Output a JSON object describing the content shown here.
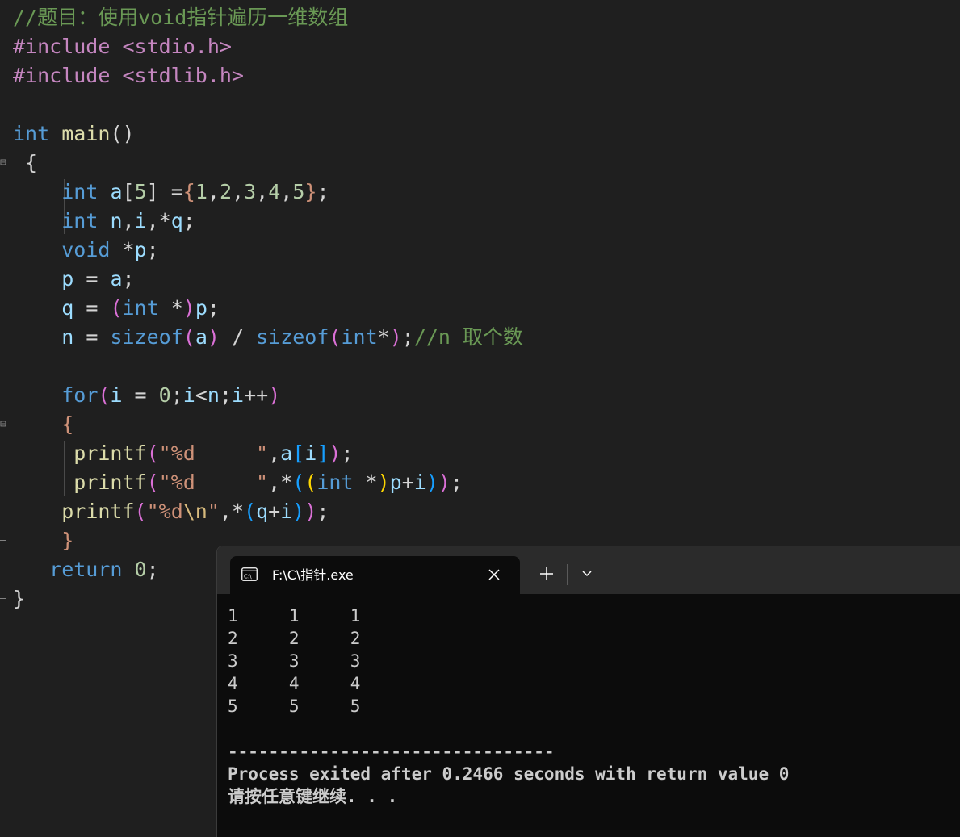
{
  "editor": {
    "lines": [
      [
        {
          "t": "//题目：使用void指针遍历一维数组",
          "c": "cm"
        }
      ],
      [
        {
          "t": "#include ",
          "c": "pp"
        },
        {
          "t": "<stdio.h>",
          "c": "pp"
        }
      ],
      [
        {
          "t": "#include ",
          "c": "pp"
        },
        {
          "t": "<stdlib.h>",
          "c": "pp"
        }
      ],
      [],
      [
        {
          "t": "int",
          "c": "kw"
        },
        {
          "t": " ",
          "c": "op"
        },
        {
          "t": "main",
          "c": "fn"
        },
        {
          "t": "()",
          "c": "op"
        }
      ],
      [
        {
          "t": " {",
          "c": "op"
        }
      ],
      [
        {
          "t": "    ",
          "c": "op"
        },
        {
          "t": "int",
          "c": "kw"
        },
        {
          "t": " ",
          "c": "op"
        },
        {
          "t": "a",
          "c": "id"
        },
        {
          "t": "[",
          "c": "op"
        },
        {
          "t": "5",
          "c": "nm"
        },
        {
          "t": "] =",
          "c": "op"
        },
        {
          "t": "{",
          "c": "br"
        },
        {
          "t": "1",
          "c": "nm"
        },
        {
          "t": ",",
          "c": "op"
        },
        {
          "t": "2",
          "c": "nm"
        },
        {
          "t": ",",
          "c": "op"
        },
        {
          "t": "3",
          "c": "nm"
        },
        {
          "t": ",",
          "c": "op"
        },
        {
          "t": "4",
          "c": "nm"
        },
        {
          "t": ",",
          "c": "op"
        },
        {
          "t": "5",
          "c": "nm"
        },
        {
          "t": "}",
          "c": "br"
        },
        {
          "t": ";",
          "c": "op"
        }
      ],
      [
        {
          "t": "    ",
          "c": "op"
        },
        {
          "t": "int",
          "c": "kw"
        },
        {
          "t": " ",
          "c": "op"
        },
        {
          "t": "n",
          "c": "id"
        },
        {
          "t": ",",
          "c": "op"
        },
        {
          "t": "i",
          "c": "id"
        },
        {
          "t": ",*",
          "c": "op"
        },
        {
          "t": "q",
          "c": "id"
        },
        {
          "t": ";",
          "c": "op"
        }
      ],
      [
        {
          "t": "    ",
          "c": "op"
        },
        {
          "t": "void",
          "c": "kw"
        },
        {
          "t": " *",
          "c": "op"
        },
        {
          "t": "p",
          "c": "id"
        },
        {
          "t": ";",
          "c": "op"
        }
      ],
      [
        {
          "t": "    ",
          "c": "op"
        },
        {
          "t": "p",
          "c": "id"
        },
        {
          "t": " = ",
          "c": "op"
        },
        {
          "t": "a",
          "c": "id"
        },
        {
          "t": ";",
          "c": "op"
        }
      ],
      [
        {
          "t": "    ",
          "c": "op"
        },
        {
          "t": "q",
          "c": "id"
        },
        {
          "t": " = ",
          "c": "op"
        },
        {
          "t": "(",
          "c": "bp"
        },
        {
          "t": "int",
          "c": "kw"
        },
        {
          "t": " *",
          "c": "op"
        },
        {
          "t": ")",
          "c": "bp"
        },
        {
          "t": "p",
          "c": "id"
        },
        {
          "t": ";",
          "c": "op"
        }
      ],
      [
        {
          "t": "    ",
          "c": "op"
        },
        {
          "t": "n",
          "c": "id"
        },
        {
          "t": " = ",
          "c": "op"
        },
        {
          "t": "sizeof",
          "c": "kw"
        },
        {
          "t": "(",
          "c": "bp"
        },
        {
          "t": "a",
          "c": "id"
        },
        {
          "t": ")",
          "c": "bp"
        },
        {
          "t": " / ",
          "c": "op"
        },
        {
          "t": "sizeof",
          "c": "kw"
        },
        {
          "t": "(",
          "c": "bp"
        },
        {
          "t": "int",
          "c": "kw"
        },
        {
          "t": "*",
          "c": "op"
        },
        {
          "t": ")",
          "c": "bp"
        },
        {
          "t": ";",
          "c": "op"
        },
        {
          "t": "//n 取个数",
          "c": "cm"
        }
      ],
      [],
      [
        {
          "t": "    ",
          "c": "op"
        },
        {
          "t": "for",
          "c": "kw"
        },
        {
          "t": "(",
          "c": "bp"
        },
        {
          "t": "i",
          "c": "id"
        },
        {
          "t": " = ",
          "c": "op"
        },
        {
          "t": "0",
          "c": "nm"
        },
        {
          "t": ";",
          "c": "op"
        },
        {
          "t": "i",
          "c": "id"
        },
        {
          "t": "<",
          "c": "op"
        },
        {
          "t": "n",
          "c": "id"
        },
        {
          "t": ";",
          "c": "op"
        },
        {
          "t": "i",
          "c": "id"
        },
        {
          "t": "++",
          "c": "op"
        },
        {
          "t": ")",
          "c": "bp"
        }
      ],
      [
        {
          "t": "    ",
          "c": "op"
        },
        {
          "t": "{",
          "c": "br"
        }
      ],
      [
        {
          "t": "     ",
          "c": "op"
        },
        {
          "t": "printf",
          "c": "fn"
        },
        {
          "t": "(",
          "c": "bp"
        },
        {
          "t": "\"%d     \"",
          "c": "st"
        },
        {
          "t": ",",
          "c": "op"
        },
        {
          "t": "a",
          "c": "id"
        },
        {
          "t": "[",
          "c": "bf"
        },
        {
          "t": "i",
          "c": "id"
        },
        {
          "t": "]",
          "c": "bf"
        },
        {
          "t": ")",
          "c": "bp"
        },
        {
          "t": ";",
          "c": "op"
        }
      ],
      [
        {
          "t": "     ",
          "c": "op"
        },
        {
          "t": "printf",
          "c": "fn"
        },
        {
          "t": "(",
          "c": "bp"
        },
        {
          "t": "\"%d     \"",
          "c": "st"
        },
        {
          "t": ",*",
          "c": "op"
        },
        {
          "t": "(",
          "c": "bf"
        },
        {
          "t": "(",
          "c": "by"
        },
        {
          "t": "int",
          "c": "kw"
        },
        {
          "t": " *",
          "c": "op"
        },
        {
          "t": ")",
          "c": "by"
        },
        {
          "t": "p",
          "c": "id"
        },
        {
          "t": "+",
          "c": "op"
        },
        {
          "t": "i",
          "c": "id"
        },
        {
          "t": ")",
          "c": "bf"
        },
        {
          "t": ")",
          "c": "bp"
        },
        {
          "t": ";",
          "c": "op"
        }
      ],
      [
        {
          "t": "    ",
          "c": "op"
        },
        {
          "t": "printf",
          "c": "fn"
        },
        {
          "t": "(",
          "c": "bp"
        },
        {
          "t": "\"%d",
          "c": "st"
        },
        {
          "t": "\\n",
          "c": "es"
        },
        {
          "t": "\"",
          "c": "st"
        },
        {
          "t": ",*",
          "c": "op"
        },
        {
          "t": "(",
          "c": "bf"
        },
        {
          "t": "q",
          "c": "id"
        },
        {
          "t": "+",
          "c": "op"
        },
        {
          "t": "i",
          "c": "id"
        },
        {
          "t": ")",
          "c": "bf"
        },
        {
          "t": ")",
          "c": "bp"
        },
        {
          "t": ";",
          "c": "op"
        }
      ],
      [
        {
          "t": "    ",
          "c": "op"
        },
        {
          "t": "}",
          "c": "br"
        }
      ],
      [
        {
          "t": "   ",
          "c": "op"
        },
        {
          "t": "return",
          "c": "kw"
        },
        {
          "t": " ",
          "c": "op"
        },
        {
          "t": "0",
          "c": "nm"
        },
        {
          "t": ";",
          "c": "op"
        }
      ],
      [
        {
          "t": "}",
          "c": "op"
        }
      ]
    ]
  },
  "terminal": {
    "tab_title": "F:\\C\\指针.exe",
    "icon": "console-app-icon",
    "output": [
      {
        "text": "1     1     1",
        "bold": false
      },
      {
        "text": "2     2     2",
        "bold": false
      },
      {
        "text": "3     3     3",
        "bold": false
      },
      {
        "text": "4     4     4",
        "bold": false
      },
      {
        "text": "5     5     5",
        "bold": false
      },
      {
        "text": "",
        "bold": false
      },
      {
        "text": "--------------------------------",
        "bold": true
      },
      {
        "text": "Process exited after 0.2466 seconds with return value 0",
        "bold": true
      },
      {
        "text": "请按任意键继续. . .",
        "bold": true
      }
    ]
  },
  "colors": {
    "editor_bg": "#1f1f1f",
    "terminal_bg": "#0c0c0c",
    "titlebar_bg": "#2b2b2b",
    "comment": "#6a9955",
    "keyword": "#569cd6",
    "function": "#dcdcaa",
    "string": "#ce9178"
  }
}
